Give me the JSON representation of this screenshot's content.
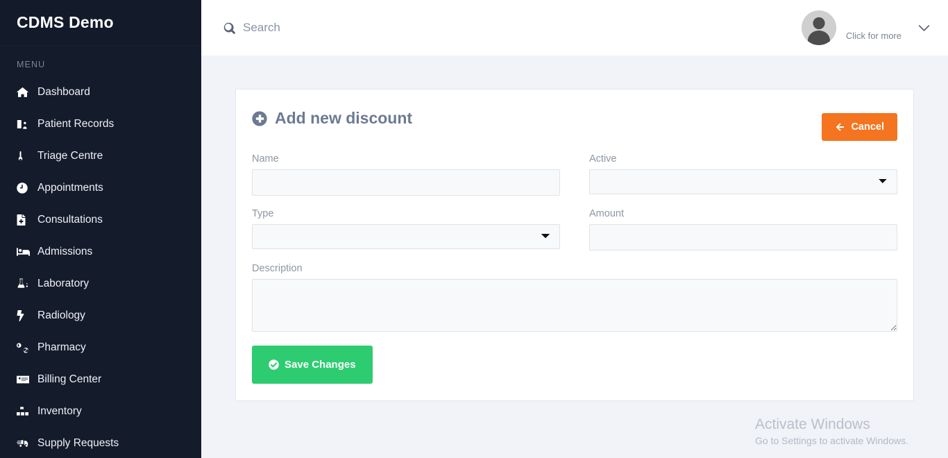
{
  "sidebar": {
    "brand": "CDMS Demo",
    "menu_label": "MENU",
    "items": [
      {
        "label": "Dashboard",
        "icon": "home-icon"
      },
      {
        "label": "Patient Records",
        "icon": "patient-records-icon"
      },
      {
        "label": "Triage Centre",
        "icon": "thermometer-icon"
      },
      {
        "label": "Appointments",
        "icon": "clock-icon"
      },
      {
        "label": "Consultations",
        "icon": "file-medical-icon"
      },
      {
        "label": "Admissions",
        "icon": "hospital-bed-icon"
      },
      {
        "label": "Laboratory",
        "icon": "flask-icon"
      },
      {
        "label": "Radiology",
        "icon": "bolt-icon"
      },
      {
        "label": "Pharmacy",
        "icon": "pills-icon"
      },
      {
        "label": "Billing Center",
        "icon": "money-check-icon"
      },
      {
        "label": "Inventory",
        "icon": "boxes-icon"
      },
      {
        "label": "Supply Requests",
        "icon": "truck-icon"
      }
    ]
  },
  "topbar": {
    "search_placeholder": "Search",
    "search_icon": "search-icon",
    "user_label": "Click for more",
    "avatar_icon": "user-avatar-icon",
    "caret_icon": "chevron-down-icon"
  },
  "card": {
    "title": "Add new discount",
    "title_icon": "plus-circle-icon",
    "cancel_label": "Cancel",
    "cancel_icon": "arrow-left-icon",
    "save_label": "Save Changes",
    "save_icon": "check-circle-icon",
    "fields": {
      "name": {
        "label": "Name",
        "value": "",
        "placeholder": ""
      },
      "active": {
        "label": "Active",
        "value": "",
        "options": [
          ""
        ]
      },
      "type": {
        "label": "Type",
        "value": "",
        "options": [
          ""
        ]
      },
      "amount": {
        "label": "Amount",
        "value": "",
        "placeholder": ""
      },
      "description": {
        "label": "Description",
        "value": "",
        "placeholder": ""
      }
    }
  },
  "watermark": {
    "title": "Activate Windows",
    "subtitle": "Go to Settings to activate Windows."
  },
  "colors": {
    "sidebar_bg": "#141b2b",
    "page_bg": "#f1f3f8",
    "cancel_orange": "#f4741f",
    "save_green": "#2ecc71",
    "title_slate": "#6c7a91"
  }
}
